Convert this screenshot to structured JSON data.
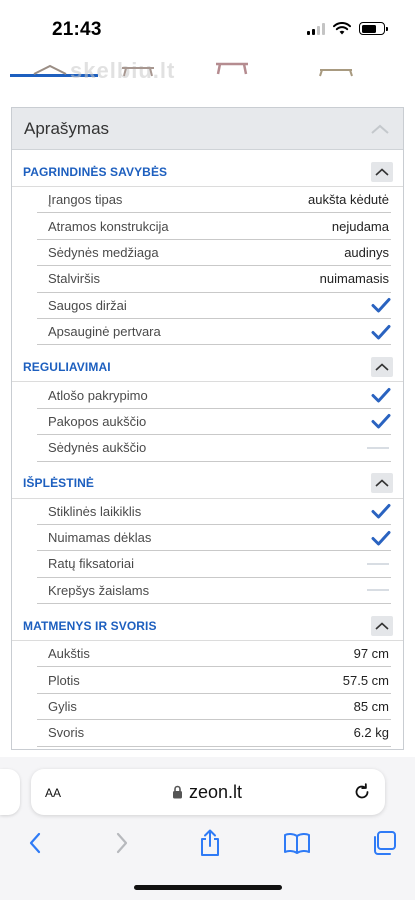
{
  "status_bar": {
    "time": "21:43",
    "battery_level": 0.7
  },
  "watermark": "skelbiu.lt",
  "accent_color": "#1d5fbf",
  "panel": {
    "title": "Aprašymas",
    "sections": [
      {
        "title": "PAGRINDINĖS SAVYBĖS",
        "rows": [
          {
            "label": "Įrangos tipas",
            "value": "aukšta kėdutė"
          },
          {
            "label": "Atramos konstrukcija",
            "value": "nejudama"
          },
          {
            "label": "Sėdynės medžiaga",
            "value": "audinys"
          },
          {
            "label": "Stalviršis",
            "value": "nuimamasis"
          },
          {
            "label": "Saugos diržai",
            "value": "check"
          },
          {
            "label": "Apsauginė pertvara",
            "value": "check"
          }
        ]
      },
      {
        "title": "REGULIAVIMAI",
        "rows": [
          {
            "label": "Atlošo pakrypimo",
            "value": "check"
          },
          {
            "label": "Pakopos aukščio",
            "value": "check"
          },
          {
            "label": "Sėdynės aukščio",
            "value": "dash"
          }
        ]
      },
      {
        "title": "IŠPLĖSTINĖ",
        "rows": [
          {
            "label": "Stiklinės laikiklis",
            "value": "check"
          },
          {
            "label": "Nuimamas dėklas",
            "value": "check"
          },
          {
            "label": "Ratų fiksatoriai",
            "value": "dash"
          },
          {
            "label": "Krepšys žaislams",
            "value": "dash"
          }
        ]
      },
      {
        "title": "MATMENYS IR SVORIS",
        "rows": [
          {
            "label": "Aukštis",
            "value": "97 cm"
          },
          {
            "label": "Plotis",
            "value": "57.5 cm"
          },
          {
            "label": "Gylis",
            "value": "85 cm"
          },
          {
            "label": "Svoris",
            "value": "6.2 kg"
          }
        ]
      }
    ]
  },
  "browser": {
    "aa_label": "AA",
    "url": "zeon.lt",
    "toolbar_icons": [
      "back-icon",
      "forward-icon",
      "share-icon",
      "bookmarks-icon",
      "tabs-icon"
    ]
  }
}
